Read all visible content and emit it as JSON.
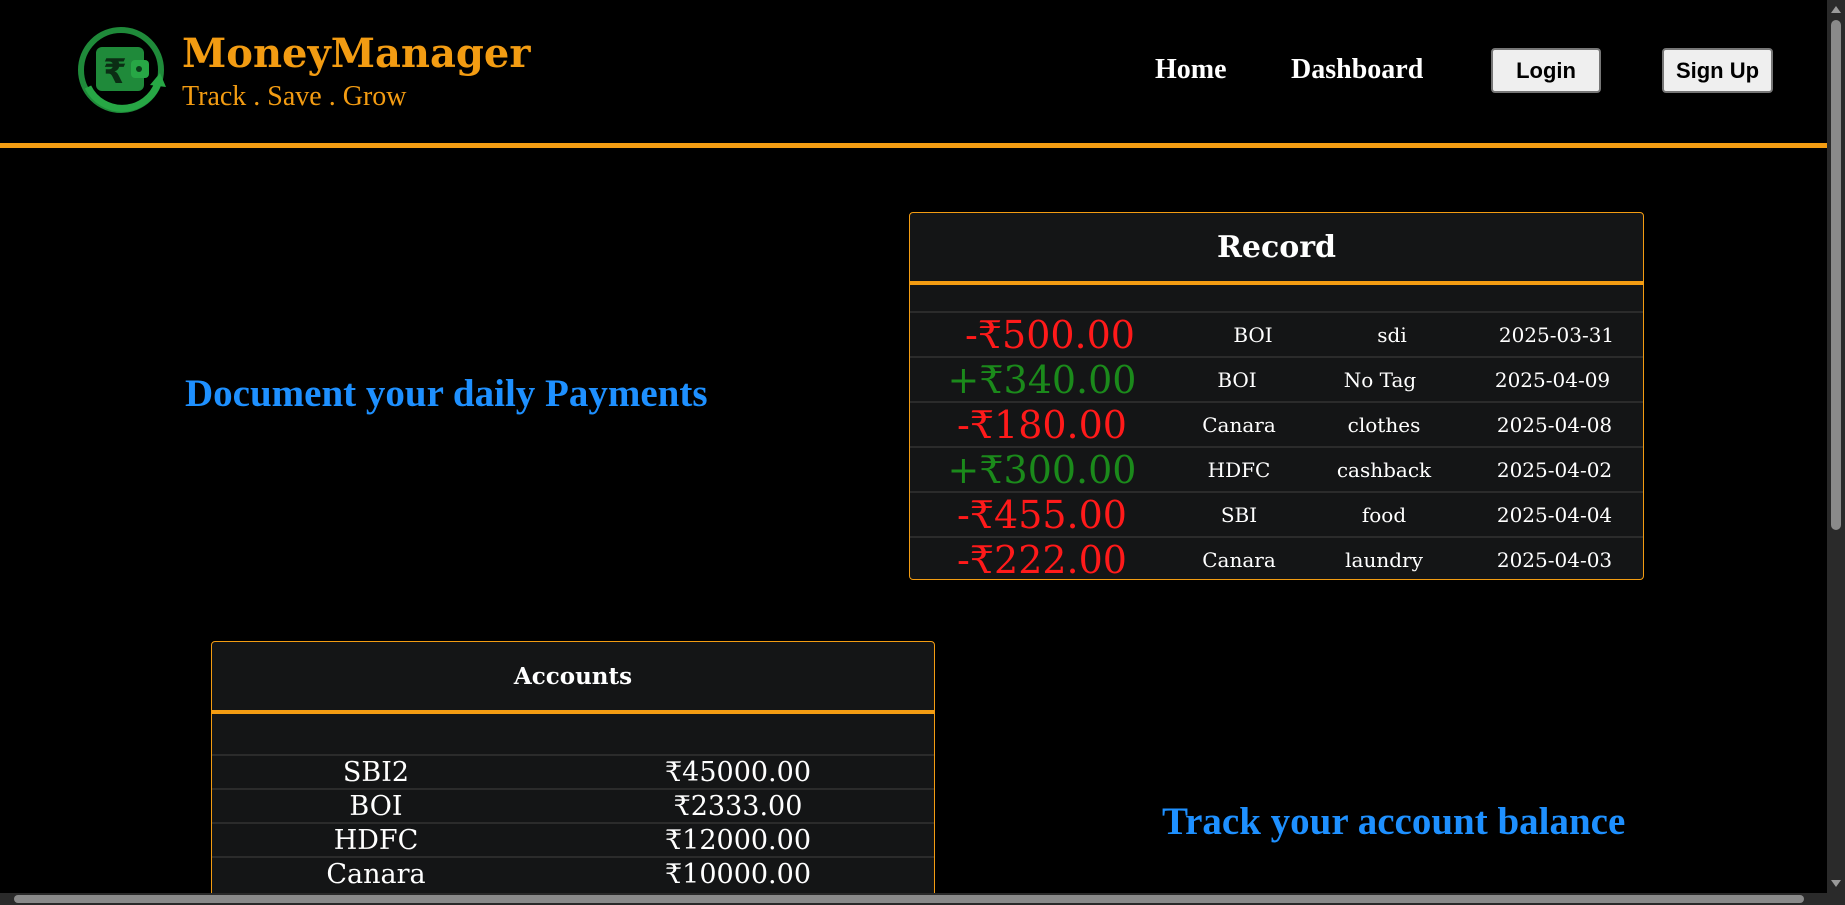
{
  "header": {
    "brand_title": "MoneyManager",
    "brand_tagline": "Track . Save . Grow",
    "nav": {
      "home": "Home",
      "dashboard": "Dashboard",
      "login": "Login",
      "signup": "Sign Up"
    }
  },
  "features": {
    "payments_text": "Document your daily Payments",
    "balance_text": "Track your account balance"
  },
  "record": {
    "title": "Record",
    "rows": [
      {
        "amount": "-₹500.00",
        "account": "BOI",
        "tag": "sdi",
        "date": "2025-03-31"
      },
      {
        "amount": "+₹340.00",
        "account": "BOI",
        "tag": "No Tag",
        "date": "2025-04-09"
      },
      {
        "amount": "-₹180.00",
        "account": "Canara",
        "tag": "clothes",
        "date": "2025-04-08"
      },
      {
        "amount": "+₹300.00",
        "account": "HDFC",
        "tag": "cashback",
        "date": "2025-04-02"
      },
      {
        "amount": "-₹455.00",
        "account": "SBI",
        "tag": "food",
        "date": "2025-04-04"
      },
      {
        "amount": "-₹222.00",
        "account": "Canara",
        "tag": "laundry",
        "date": "2025-04-03"
      }
    ]
  },
  "accounts": {
    "title": "Accounts",
    "rows": [
      {
        "name": "SBI2",
        "balance": "₹45000.00"
      },
      {
        "name": "BOI",
        "balance": "₹2333.00"
      },
      {
        "name": "HDFC",
        "balance": "₹12000.00"
      },
      {
        "name": "Canara",
        "balance": "₹10000.00"
      }
    ]
  },
  "colors": {
    "accent": "#f39c12",
    "feature_text": "#1e90ff",
    "negative": "#ff1a1a",
    "positive": "#1b8a1b",
    "background": "#000000",
    "card_background": "#141516"
  },
  "icons": {
    "logo": "rupee-wallet-growth-icon"
  }
}
